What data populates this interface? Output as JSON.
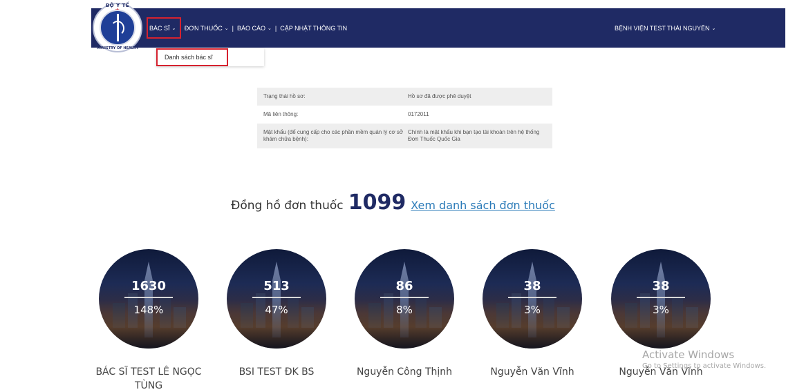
{
  "logo": {
    "top_text": "BỘ Y TẾ",
    "bottom_text": "MINISTRY OF HEALTH"
  },
  "nav": {
    "items": [
      {
        "label": "BÁC SĨ"
      },
      {
        "label": "ĐƠN THUỐC"
      },
      {
        "label": "BÁO CÁO"
      },
      {
        "label": "CẬP NHẬT THÔNG TIN"
      }
    ],
    "separator": "|",
    "hospital": "BỆNH VIỆN TEST THÁI NGUYÊN"
  },
  "dropdown": {
    "item": "Danh sách bác sĩ"
  },
  "info": {
    "rows": [
      {
        "label": "Trạng thái hồ sơ:",
        "value": "Hồ sơ đã được phê duyệt"
      },
      {
        "label": "Mã liên thông:",
        "value": "0172011"
      },
      {
        "label": "Mật khẩu (để cung cấp cho các phần mềm quản lý cơ sở khám chữa bệnh):",
        "value": "Chính là mật khẩu khi bạn tạo tài khoản trên hệ thống Đơn Thuốc Quốc Gia"
      }
    ]
  },
  "counter": {
    "label": "Đồng hồ đơn thuốc",
    "value": "1099",
    "link": "Xem danh sách đơn thuốc"
  },
  "doctors": [
    {
      "count": "1630",
      "percent": "148%",
      "name": "BÁC SĨ TEST LÊ NGỌC TÙNG"
    },
    {
      "count": "513",
      "percent": "47%",
      "name": "BSI TEST ĐK BS"
    },
    {
      "count": "86",
      "percent": "8%",
      "name": "Nguyễn Công Thịnh"
    },
    {
      "count": "38",
      "percent": "3%",
      "name": "Nguyễn Văn Vĩnh"
    },
    {
      "count": "38",
      "percent": "3%",
      "name": "Nguyễn Văn Vĩnh"
    }
  ],
  "watermark": {
    "line1": "Activate Windows",
    "line2": "Go to Settings to activate Windows."
  },
  "colors": {
    "navbar": "#1f2a64",
    "highlight": "#d6222f",
    "link": "#2a7ab8"
  }
}
